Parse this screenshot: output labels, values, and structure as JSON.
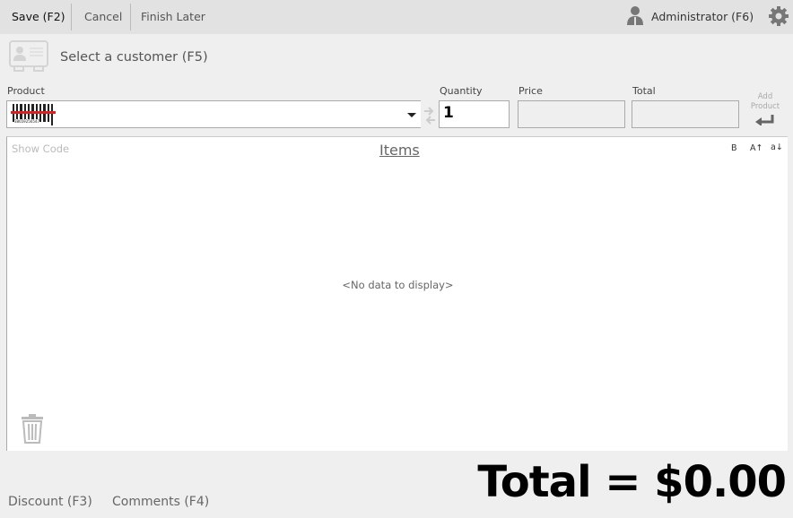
{
  "toolbar": {
    "save": "Save (F2)",
    "cancel": "Cancel",
    "finish_later": "Finish Later",
    "user": "Administrator (F6)"
  },
  "customer": {
    "label": "Select a customer (F5)"
  },
  "product_row": {
    "product_label": "Product",
    "quantity_label": "Quantity",
    "quantity_value": "1",
    "price_label": "Price",
    "price_value": "",
    "total_label": "Total",
    "total_value": "",
    "add_product_line1": "Add",
    "add_product_line2": "Product",
    "barcode_digits": "38659256547"
  },
  "grid": {
    "show_code": "Show Code",
    "title": "Items",
    "bold": "B",
    "sort_asc": "A↑",
    "sort_desc": "a↓",
    "empty": "<No data to display>"
  },
  "footer": {
    "discount": "Discount (F3)",
    "comments": "Comments (F4)",
    "total": "Total = $0.00"
  }
}
